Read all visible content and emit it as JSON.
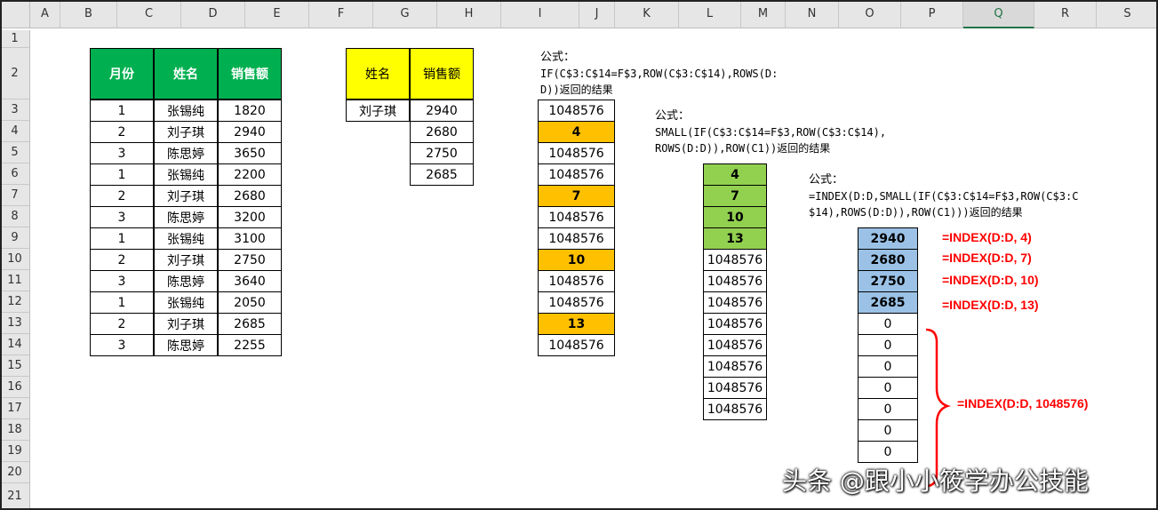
{
  "columns": [
    "A",
    "B",
    "C",
    "D",
    "E",
    "F",
    "G",
    "H",
    "I",
    "J",
    "K",
    "L",
    "M",
    "N",
    "O",
    "P",
    "Q",
    "R",
    "S"
  ],
  "active_column": "Q",
  "rows": [
    "1",
    "2",
    "3",
    "4",
    "5",
    "6",
    "7",
    "8",
    "9",
    "10",
    "11",
    "12",
    "13",
    "14",
    "15",
    "16",
    "17",
    "18",
    "19",
    "20",
    "21"
  ],
  "table1": {
    "headers": [
      "月份",
      "姓名",
      "销售额"
    ],
    "rows": [
      [
        "1",
        "张锡纯",
        "1820"
      ],
      [
        "2",
        "刘子琪",
        "2940"
      ],
      [
        "3",
        "陈思婷",
        "3650"
      ],
      [
        "1",
        "张锡纯",
        "2200"
      ],
      [
        "2",
        "刘子琪",
        "2680"
      ],
      [
        "3",
        "陈思婷",
        "3200"
      ],
      [
        "1",
        "张锡纯",
        "3100"
      ],
      [
        "2",
        "刘子琪",
        "2750"
      ],
      [
        "3",
        "陈思婷",
        "3640"
      ],
      [
        "1",
        "张锡纯",
        "2050"
      ],
      [
        "2",
        "刘子琪",
        "2685"
      ],
      [
        "3",
        "陈思婷",
        "2255"
      ]
    ]
  },
  "table2": {
    "headers": [
      "姓名",
      "销售额"
    ],
    "name": "刘子琪",
    "values": [
      "2940",
      "2680",
      "2750",
      "2685"
    ]
  },
  "notes": {
    "n1_line1": "公式：",
    "n1_line2": "IF(C$3:C$14=F$3,ROW(C$3:C$14),ROWS(D:",
    "n1_line3": "D))返回的结果",
    "n2_line1": "公式：",
    "n2_line2": "SMALL(IF(C$3:C$14=F$3,ROW(C$3:C$14),",
    "n2_line3": "ROWS(D:D)),ROW(C1))返回的结果",
    "n3_line1": "公式：",
    "n3_line2": "=INDEX(D:D,SMALL(IF(C$3:C$14=F$3,ROW(C$3:C",
    "n3_line3": "$14),ROWS(D:D)),ROW(C1)))返回的结果"
  },
  "colI": [
    "1048576",
    "4",
    "1048576",
    "1048576",
    "7",
    "1048576",
    "1048576",
    "10",
    "1048576",
    "1048576",
    "13",
    "1048576"
  ],
  "colL": [
    "4",
    "7",
    "10",
    "13",
    "1048576",
    "1048576",
    "1048576",
    "1048576",
    "1048576",
    "1048576",
    "1048576",
    "1048576"
  ],
  "colO": [
    "2940",
    "2680",
    "2750",
    "2685",
    "0",
    "0",
    "0",
    "0",
    "0",
    "0",
    "0"
  ],
  "red_labels": {
    "r1": "=INDEX(D:D, 4)",
    "r2": "=INDEX(D:D, 7)",
    "r3": "=INDEX(D:D, 10)",
    "r4": "=INDEX(D:D, 13)",
    "r5": "=INDEX(D:D, 1048576)"
  },
  "watermark": "头条 @跟小小筱学办公技能",
  "colors": {
    "header_green": "#00b050",
    "header_yellow": "#ffff00",
    "highlight_orange": "#ffc000",
    "highlight_green": "#92d050",
    "highlight_blue": "#9bc2e6",
    "label_red": "#ff0000"
  }
}
